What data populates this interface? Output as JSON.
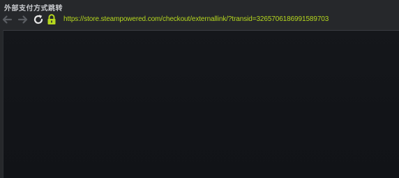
{
  "window": {
    "title": "外部支付方式跳转"
  },
  "navbar": {
    "back_icon": "arrow-left-icon",
    "forward_icon": "arrow-right-icon",
    "reload_icon": "reload-icon",
    "lock_icon": "lock-icon",
    "url": "https://store.steampowered.com/checkout/externallink/?transid=3265706186991589703"
  },
  "colors": {
    "url_text": "#b6d81e",
    "lock": "#b6d81e",
    "nav_disabled": "#5b5e63",
    "reload": "#e6e6e6",
    "content_bg": "#131519"
  }
}
